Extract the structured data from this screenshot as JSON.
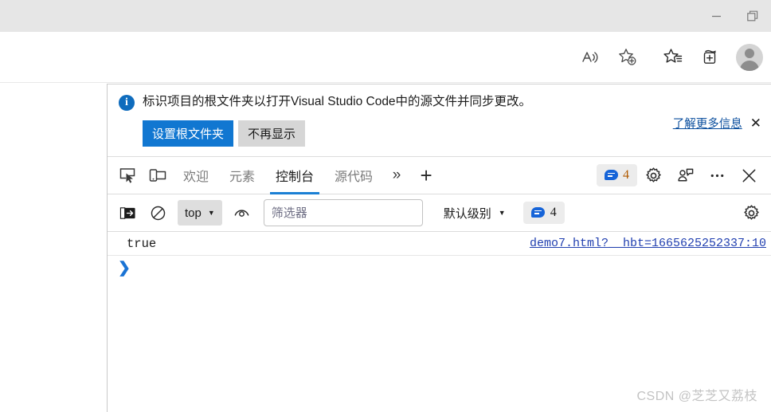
{
  "window": {
    "controls": [
      {
        "name": "minimize",
        "glyph": "—"
      },
      {
        "name": "restore",
        "glyph": ""
      }
    ]
  },
  "browser_toolbar": {
    "icons": [
      {
        "name": "read-aloud-icon",
        "title": "朗读此页面"
      },
      {
        "name": "add-favorite-icon",
        "title": "添加到收藏夹"
      },
      {
        "name": "favorites-icon",
        "title": "收藏夹"
      },
      {
        "name": "collections-icon",
        "title": "集锊"
      },
      {
        "name": "profile-avatar",
        "title": "个人资料"
      }
    ]
  },
  "infobar": {
    "icon": "info-icon",
    "message": "标识项目的根文件夹以打开Visual Studio Code中的源文件并同步更改。",
    "primary_button": "设置根文件夹",
    "secondary_button": "不再显示",
    "learn_more": "了解更多信息",
    "close": "✕",
    "accent_color": "#1177d1",
    "link_color": "#0b4f9e"
  },
  "devtools_tabs": {
    "left_icons": [
      {
        "name": "inspect-element-icon"
      },
      {
        "name": "device-emulation-icon"
      }
    ],
    "tabs": [
      {
        "label": "欢迎",
        "active": false,
        "name": "tab-welcome"
      },
      {
        "label": "元素",
        "active": false,
        "name": "tab-elements"
      },
      {
        "label": "控制台",
        "active": true,
        "name": "tab-console"
      },
      {
        "label": "源代码",
        "active": false,
        "name": "tab-sources"
      }
    ],
    "overflow": "»",
    "add_tab": "+",
    "issues_count": "4",
    "right_icons": [
      {
        "name": "settings-gear-icon"
      },
      {
        "name": "feedback-icon"
      },
      {
        "name": "more-options-icon"
      },
      {
        "name": "close-devtools-icon"
      }
    ],
    "active_underline_color": "#1a7fd4"
  },
  "console_toolbar": {
    "sidebar_toggle": "console-sidebar-icon",
    "clear_console": "clear-console-icon",
    "context_selector": {
      "label": "top",
      "caret": "▼"
    },
    "live_expression": "eye-icon",
    "filter": {
      "value": "",
      "placeholder": "筛选器"
    },
    "level_selector": {
      "label": "默认级别",
      "caret": "▼"
    },
    "issues_count": "4",
    "settings": "console-settings-gear-icon"
  },
  "console_output": {
    "entries": [
      {
        "value": "true",
        "source": "demo7.html?__hbt=1665625252337:10"
      }
    ],
    "prompt": {
      "chevron": "❯",
      "value": "",
      "placeholder": ""
    },
    "link_color": "#2240b0"
  },
  "watermark": {
    "text": "CSDN @芝芝又荔枝"
  }
}
